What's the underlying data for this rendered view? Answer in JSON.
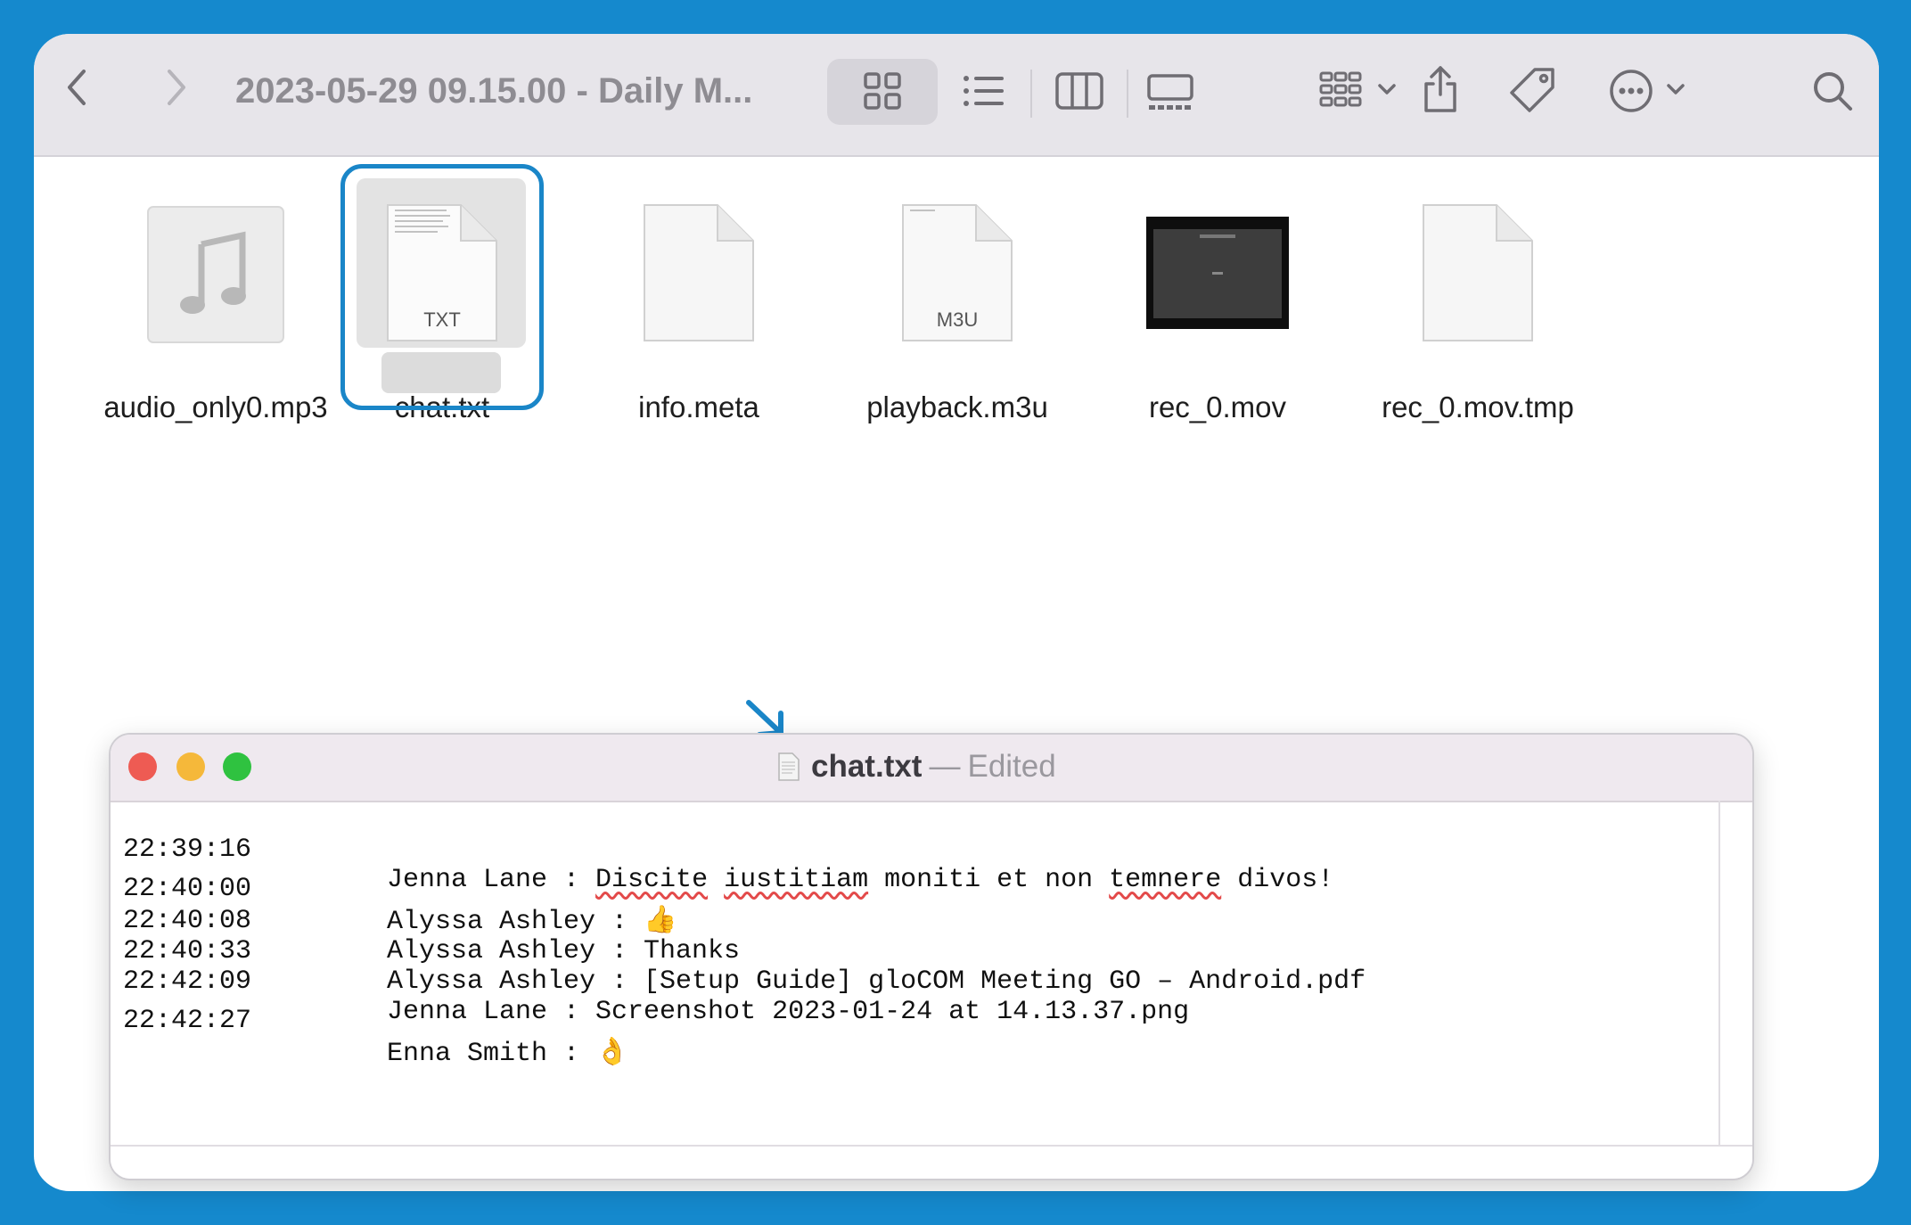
{
  "toolbar": {
    "title": "2023-05-29 09.15.00 - Daily M...",
    "icons": [
      "back-icon",
      "forward-icon",
      "grid-view-icon",
      "list-view-icon",
      "column-view-icon",
      "gallery-view-icon",
      "group-icon",
      "share-icon",
      "tag-icon",
      "more-icon",
      "search-icon"
    ]
  },
  "files": [
    {
      "name": "audio_only0.mp3",
      "kind": "audio"
    },
    {
      "name": "chat.txt",
      "kind": "text",
      "badge": "TXT"
    },
    {
      "name": "info.meta",
      "kind": "generic"
    },
    {
      "name": "playback.m3u",
      "kind": "playlist",
      "badge": "M3U"
    },
    {
      "name": "rec_0.mov",
      "kind": "video"
    },
    {
      "name": "rec_0.mov.tmp",
      "kind": "generic"
    }
  ],
  "editor": {
    "filename": "chat.txt",
    "separator": "—",
    "status": "Edited",
    "lines": [
      {
        "time": "22:39:16",
        "pre": "Jenna Lane : ",
        "w1": "Discite",
        "s1": " ",
        "w2": "iustitiam",
        "mid": " moniti et non ",
        "w3": "temnere",
        "post": " divos!"
      },
      {
        "time": "22:40:00",
        "text": "Alyssa Ashley : 👍"
      },
      {
        "time": "22:40:08",
        "text": "Alyssa Ashley : Thanks"
      },
      {
        "time": "22:40:33",
        "text": "Alyssa Ashley : [Setup Guide] gloCOM Meeting GO – Android.pdf"
      },
      {
        "time": "22:42:09",
        "text": "Jenna Lane : Screenshot 2023-01-24 at 14.13.37.png"
      },
      {
        "time": "22:42:27",
        "text": "Enna Smith : 👌"
      }
    ]
  },
  "colors": {
    "frame": "#1589cd",
    "selection": "#1a86c8",
    "close": "#ee5b53",
    "minimize": "#f5b83a",
    "zoom": "#2fc240"
  }
}
